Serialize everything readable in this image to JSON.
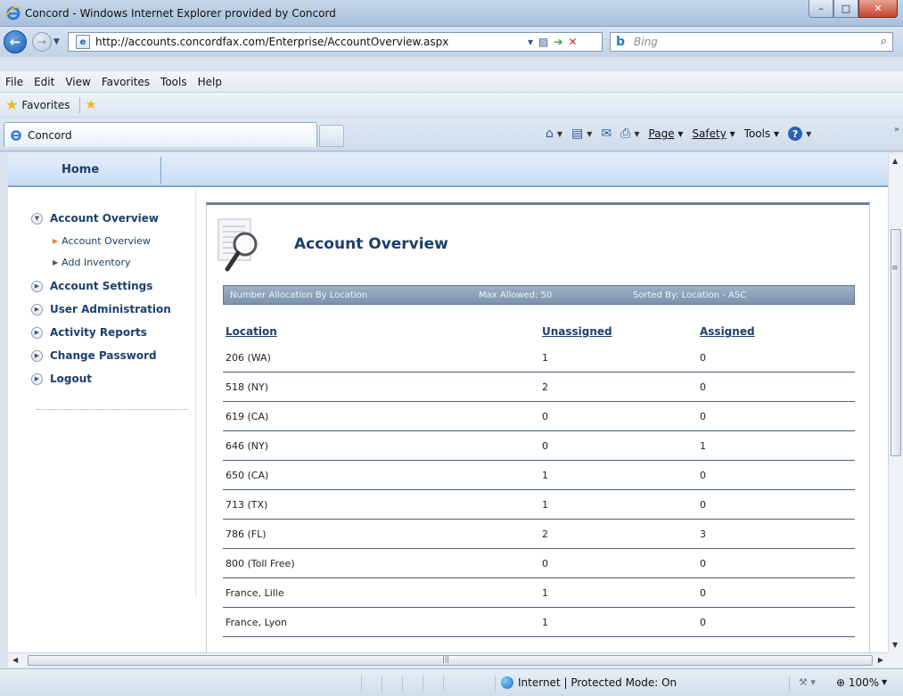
{
  "window": {
    "title": "Concord - Windows Internet Explorer provided by Concord"
  },
  "address_bar": {
    "url": "http://accounts.concordfax.com/Enterprise/AccountOverview.aspx"
  },
  "search": {
    "engine": "Bing"
  },
  "menu": [
    {
      "label": "File"
    },
    {
      "label": "Edit"
    },
    {
      "label": "View"
    },
    {
      "label": "Favorites"
    },
    {
      "label": "Tools"
    },
    {
      "label": "Help"
    }
  ],
  "favorites_bar": {
    "label": "Favorites"
  },
  "tab": {
    "label": "Concord"
  },
  "command_bar": {
    "page": "Page",
    "safety": "Safety",
    "tools": "Tools"
  },
  "site_nav": {
    "home": "Home"
  },
  "sidebar": {
    "items": [
      {
        "label": "Account Overview",
        "expanded": true
      },
      {
        "label": "Account Settings"
      },
      {
        "label": "User Administration"
      },
      {
        "label": "Activity Reports"
      },
      {
        "label": "Change Password"
      },
      {
        "label": "Logout"
      }
    ],
    "subitems": [
      {
        "label": "Account Overview",
        "active": true
      },
      {
        "label": "Add Inventory"
      }
    ]
  },
  "content": {
    "title": "Account Overview",
    "band": {
      "left": "Number Allocation By Location",
      "middle": "Max Allowed: 50",
      "right": "Sorted By: Location - ASC"
    },
    "columns": [
      "Location",
      "Unassigned",
      "Assigned"
    ],
    "rows": [
      [
        "206 (WA)",
        "1",
        "0"
      ],
      [
        "518 (NY)",
        "2",
        "0"
      ],
      [
        "619 (CA)",
        "0",
        "0"
      ],
      [
        "646 (NY)",
        "0",
        "1"
      ],
      [
        "650 (CA)",
        "1",
        "0"
      ],
      [
        "713 (TX)",
        "1",
        "0"
      ],
      [
        "786 (FL)",
        "2",
        "3"
      ],
      [
        "800 (Toll Free)",
        "0",
        "0"
      ],
      [
        "France, Lille",
        "1",
        "0"
      ],
      [
        "France, Lyon",
        "1",
        "0"
      ]
    ]
  },
  "status_bar": {
    "zone": "Internet | Protected Mode: On",
    "zoom": "100%"
  }
}
